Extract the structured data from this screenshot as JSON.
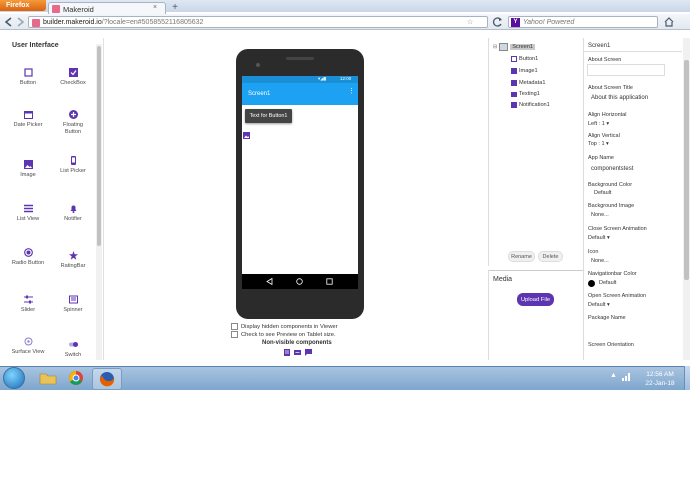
{
  "browser": {
    "app_button": "Firefox",
    "tab_title": "Makeroid",
    "new_tab": "+",
    "url_domain": "builder.makeroid.io",
    "url_rest": "/?locale=en#5058552116805632",
    "search_placeholder": "Yahoo! Powered"
  },
  "palette": {
    "title": "User Interface",
    "items": [
      {
        "label": "Button",
        "icon": "button-icon"
      },
      {
        "label": "CheckBox",
        "icon": "checkbox-icon"
      },
      {
        "label": "Date Picker",
        "icon": "calendar-icon"
      },
      {
        "label": "Floating Button",
        "icon": "floating-add-icon"
      },
      {
        "label": "Image",
        "icon": "image-icon"
      },
      {
        "label": "List Picker",
        "icon": "list-picker-icon"
      },
      {
        "label": "List View",
        "icon": "list-view-icon"
      },
      {
        "label": "Notifier",
        "icon": "bell-icon"
      },
      {
        "label": "Radio Button",
        "icon": "radio-icon"
      },
      {
        "label": "RatingBar",
        "icon": "star-icon"
      },
      {
        "label": "Slider",
        "icon": "slider-icon"
      },
      {
        "label": "Spinner",
        "icon": "spinner-icon"
      },
      {
        "label": "Surface View",
        "icon": "surface-view-icon"
      },
      {
        "label": "Switch",
        "icon": "switch-icon"
      }
    ]
  },
  "viewer": {
    "time": "12:00",
    "screen_title": "Screen1",
    "button_text": "Text for Button1",
    "check_hidden": "Display hidden components in Viewer",
    "check_tablet": "Check to see Preview on Tablet size.",
    "nonvisible_title": "Non-visible components"
  },
  "components": {
    "tree": [
      "Screen1",
      "Button1",
      "Image1",
      "Metadata1",
      "Texting1",
      "Notification1"
    ],
    "rename": "Rename",
    "delete": "Delete"
  },
  "media": {
    "title": "Media",
    "upload": "Upload File"
  },
  "properties": {
    "header": "Screen1",
    "about_screen_label": "About Screen",
    "about_title_label": "About Screen Title",
    "about_title_value": "About this application",
    "align_h_label": "Align Horizontal",
    "align_h_value": "Left : 1 ▾",
    "align_v_label": "Align Vertical",
    "align_v_value": "Top : 1 ▾",
    "app_name_label": "App Name",
    "app_name_value": "componentstest",
    "bg_color_label": "Background Color",
    "bg_color_value": "Default",
    "bg_image_label": "Background Image",
    "bg_image_value": "None...",
    "close_anim_label": "Close Screen Animation",
    "close_anim_value": "Default ▾",
    "icon_label": "Icon",
    "icon_value": "None...",
    "navbar_color_label": "Navigationbar Color",
    "navbar_color_value": "Default",
    "open_anim_label": "Open Screen Animation",
    "open_anim_value": "Default ▾",
    "package_label": "Package Name",
    "orientation_label": "Screen Orientation"
  },
  "taskbar": {
    "time": "12:56 AM",
    "date": "22-Jan-18"
  },
  "colors": {
    "accent": "#5e35b1",
    "appbar": "#1da1f2"
  }
}
